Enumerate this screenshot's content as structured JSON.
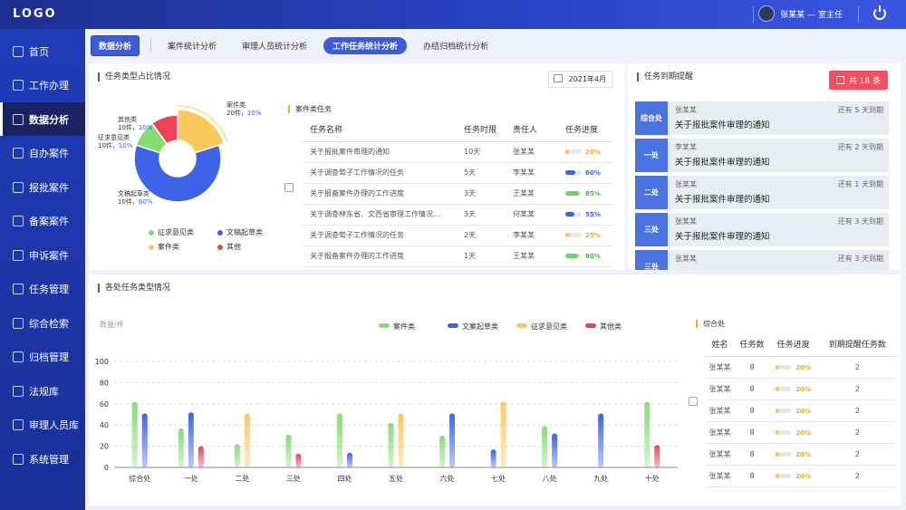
{
  "header": {
    "logo": "LOGO",
    "user": "张某某 — 室主任"
  },
  "sidebar": {
    "items": [
      {
        "label": "首页",
        "icon": "home-icon"
      },
      {
        "label": "工作办理",
        "icon": "briefcase-icon"
      },
      {
        "label": "数据分析",
        "icon": "gauge-icon",
        "active": true
      },
      {
        "label": "自办案件",
        "icon": "file-icon"
      },
      {
        "label": "报批案件",
        "icon": "document-edit-icon"
      },
      {
        "label": "备案案件",
        "icon": "archive-icon"
      },
      {
        "label": "申诉案件",
        "icon": "appeal-icon"
      },
      {
        "label": "任务管理",
        "icon": "task-icon"
      },
      {
        "label": "综合检索",
        "icon": "grid-icon"
      },
      {
        "label": "归档管理",
        "icon": "folder-icon"
      },
      {
        "label": "法规库",
        "icon": "scale-icon"
      },
      {
        "label": "审理人员库",
        "icon": "users-icon"
      },
      {
        "label": "系统管理",
        "icon": "settings-icon"
      }
    ]
  },
  "tabs": {
    "main": "数据分析",
    "items": [
      "案件统计分析",
      "审理人员统计分析",
      "工作任务统计分析",
      "办结归档统计分析"
    ],
    "active": 2
  },
  "typePanel": {
    "title": "任务类型占比情况",
    "date": "2021年4月",
    "pie": [
      {
        "name": "案件类",
        "count": "20件",
        "pct": "20%",
        "value": 20,
        "color": "#fdc85a"
      },
      {
        "name": "文稿起草类",
        "count": "10件",
        "pct": "60%",
        "value": 60,
        "color": "#3e63e8"
      },
      {
        "name": "征求意见类",
        "count": "10件",
        "pct": "10%",
        "value": 10,
        "color": "#86dd74"
      },
      {
        "name": "其他类",
        "count": "10件",
        "pct": "10%",
        "value": 10,
        "color": "#f0405a"
      }
    ],
    "legend": [
      "征求意见类",
      "文稿起草类",
      "案件类",
      "其他"
    ],
    "subtitle": "案件类任务",
    "table": {
      "headers": [
        "任务名称",
        "任务时限",
        "责任人",
        "任务进度"
      ],
      "rows": [
        {
          "name": "关于报批案件审理的通知",
          "deadline": "10天",
          "owner": "张某某",
          "progress": "20%",
          "p": 0.2,
          "color": "#fdc85a"
        },
        {
          "name": "关于调查萄子工作情况的任务",
          "deadline": "5天",
          "owner": "李某某",
          "progress": "60%",
          "p": 0.6,
          "color": "#3e63e8"
        },
        {
          "name": "关于报备案件办理的工作进度",
          "deadline": "3天",
          "owner": "王某某",
          "progress": "85%",
          "p": 0.85,
          "color": "#6dd36a"
        },
        {
          "name": "关于调查林东省、文西省审理工作情况...",
          "deadline": "3天",
          "owner": "何某某",
          "progress": "55%",
          "p": 0.55,
          "color": "#3e63e8"
        },
        {
          "name": "关于调查萄子工作情况的任务",
          "deadline": "2天",
          "owner": "李某某",
          "progress": "25%",
          "p": 0.25,
          "color": "#fdc85a"
        },
        {
          "name": "关于报备案件办理的工作进度",
          "deadline": "1天",
          "owner": "王某某",
          "progress": "80%",
          "p": 0.8,
          "color": "#6dd36a"
        }
      ]
    }
  },
  "reminder": {
    "title": "任务到期提醒",
    "badge": "共 18 条",
    "items": [
      {
        "tag": "综合处",
        "name": "张某某",
        "title": "关于报批案件审理的通知",
        "pre": "还有 ",
        "days": "5",
        "post": " 天到期"
      },
      {
        "tag": "一处",
        "name": "李某某",
        "title": "关于报批案件审理的通知",
        "pre": "还有 ",
        "days": "2",
        "post": " 天到期"
      },
      {
        "tag": "二处",
        "name": "张某某",
        "title": "关于报批案件审理的通知",
        "pre": "还有 ",
        "days": "1",
        "post": " 天到期"
      },
      {
        "tag": "三处",
        "name": "张某某",
        "title": "关于报批案件审理的通知",
        "pre": "还有 ",
        "days": "3",
        "post": " 天到期"
      },
      {
        "tag": "三处",
        "name": "张某某",
        "title": "",
        "pre": "还有 ",
        "days": "3",
        "post": " 天到期"
      }
    ]
  },
  "deptPanel": {
    "title": "各处任务类型情况",
    "sideLabel": "综合处",
    "sideTable": {
      "headers": [
        "姓名",
        "任务数",
        "任务进度",
        "到期提醒任务数"
      ],
      "rows": [
        {
          "name": "张某某",
          "count": "8",
          "progress": "20%",
          "due": "2"
        },
        {
          "name": "张某某",
          "count": "8",
          "progress": "20%",
          "due": "2"
        },
        {
          "name": "张某某",
          "count": "8",
          "progress": "20%",
          "due": "2"
        },
        {
          "name": "张某某",
          "count": "8",
          "progress": "20%",
          "due": "2"
        },
        {
          "name": "张某某",
          "count": "8",
          "progress": "20%",
          "due": "2"
        },
        {
          "name": "张某某",
          "count": "8",
          "progress": "20%",
          "due": "2"
        }
      ]
    }
  },
  "colors": {
    "accent": "#3b5bdb",
    "sidebar": "#1f3cb8",
    "warn": "#f05060"
  },
  "chart_data": {
    "type": "bar",
    "title": "",
    "ylabel": "数量/件",
    "ylim": [
      0,
      100
    ],
    "yticks": [
      0,
      20,
      40,
      60,
      80,
      100
    ],
    "categories": [
      "综合处",
      "一处",
      "二处",
      "三处",
      "四处",
      "五处",
      "六处",
      "七处",
      "八处",
      "九处",
      "十处"
    ],
    "series": [
      {
        "name": "案件类",
        "color": "#86dd74",
        "values": [
          62,
          37,
          22,
          31,
          51,
          42,
          30,
          0,
          39,
          0,
          62
        ]
      },
      {
        "name": "文案起草类",
        "color": "#3e63e8",
        "values": [
          51,
          52,
          0,
          0,
          14,
          0,
          51,
          17,
          32,
          51,
          0
        ]
      },
      {
        "name": "征求意见类",
        "color": "#fdc85a",
        "values": [
          0,
          0,
          51,
          0,
          0,
          51,
          0,
          62,
          0,
          0,
          0
        ]
      },
      {
        "name": "其他类",
        "color": "#f0405a",
        "values": [
          0,
          20,
          0,
          13,
          0,
          0,
          0,
          0,
          0,
          0,
          21
        ]
      }
    ]
  }
}
